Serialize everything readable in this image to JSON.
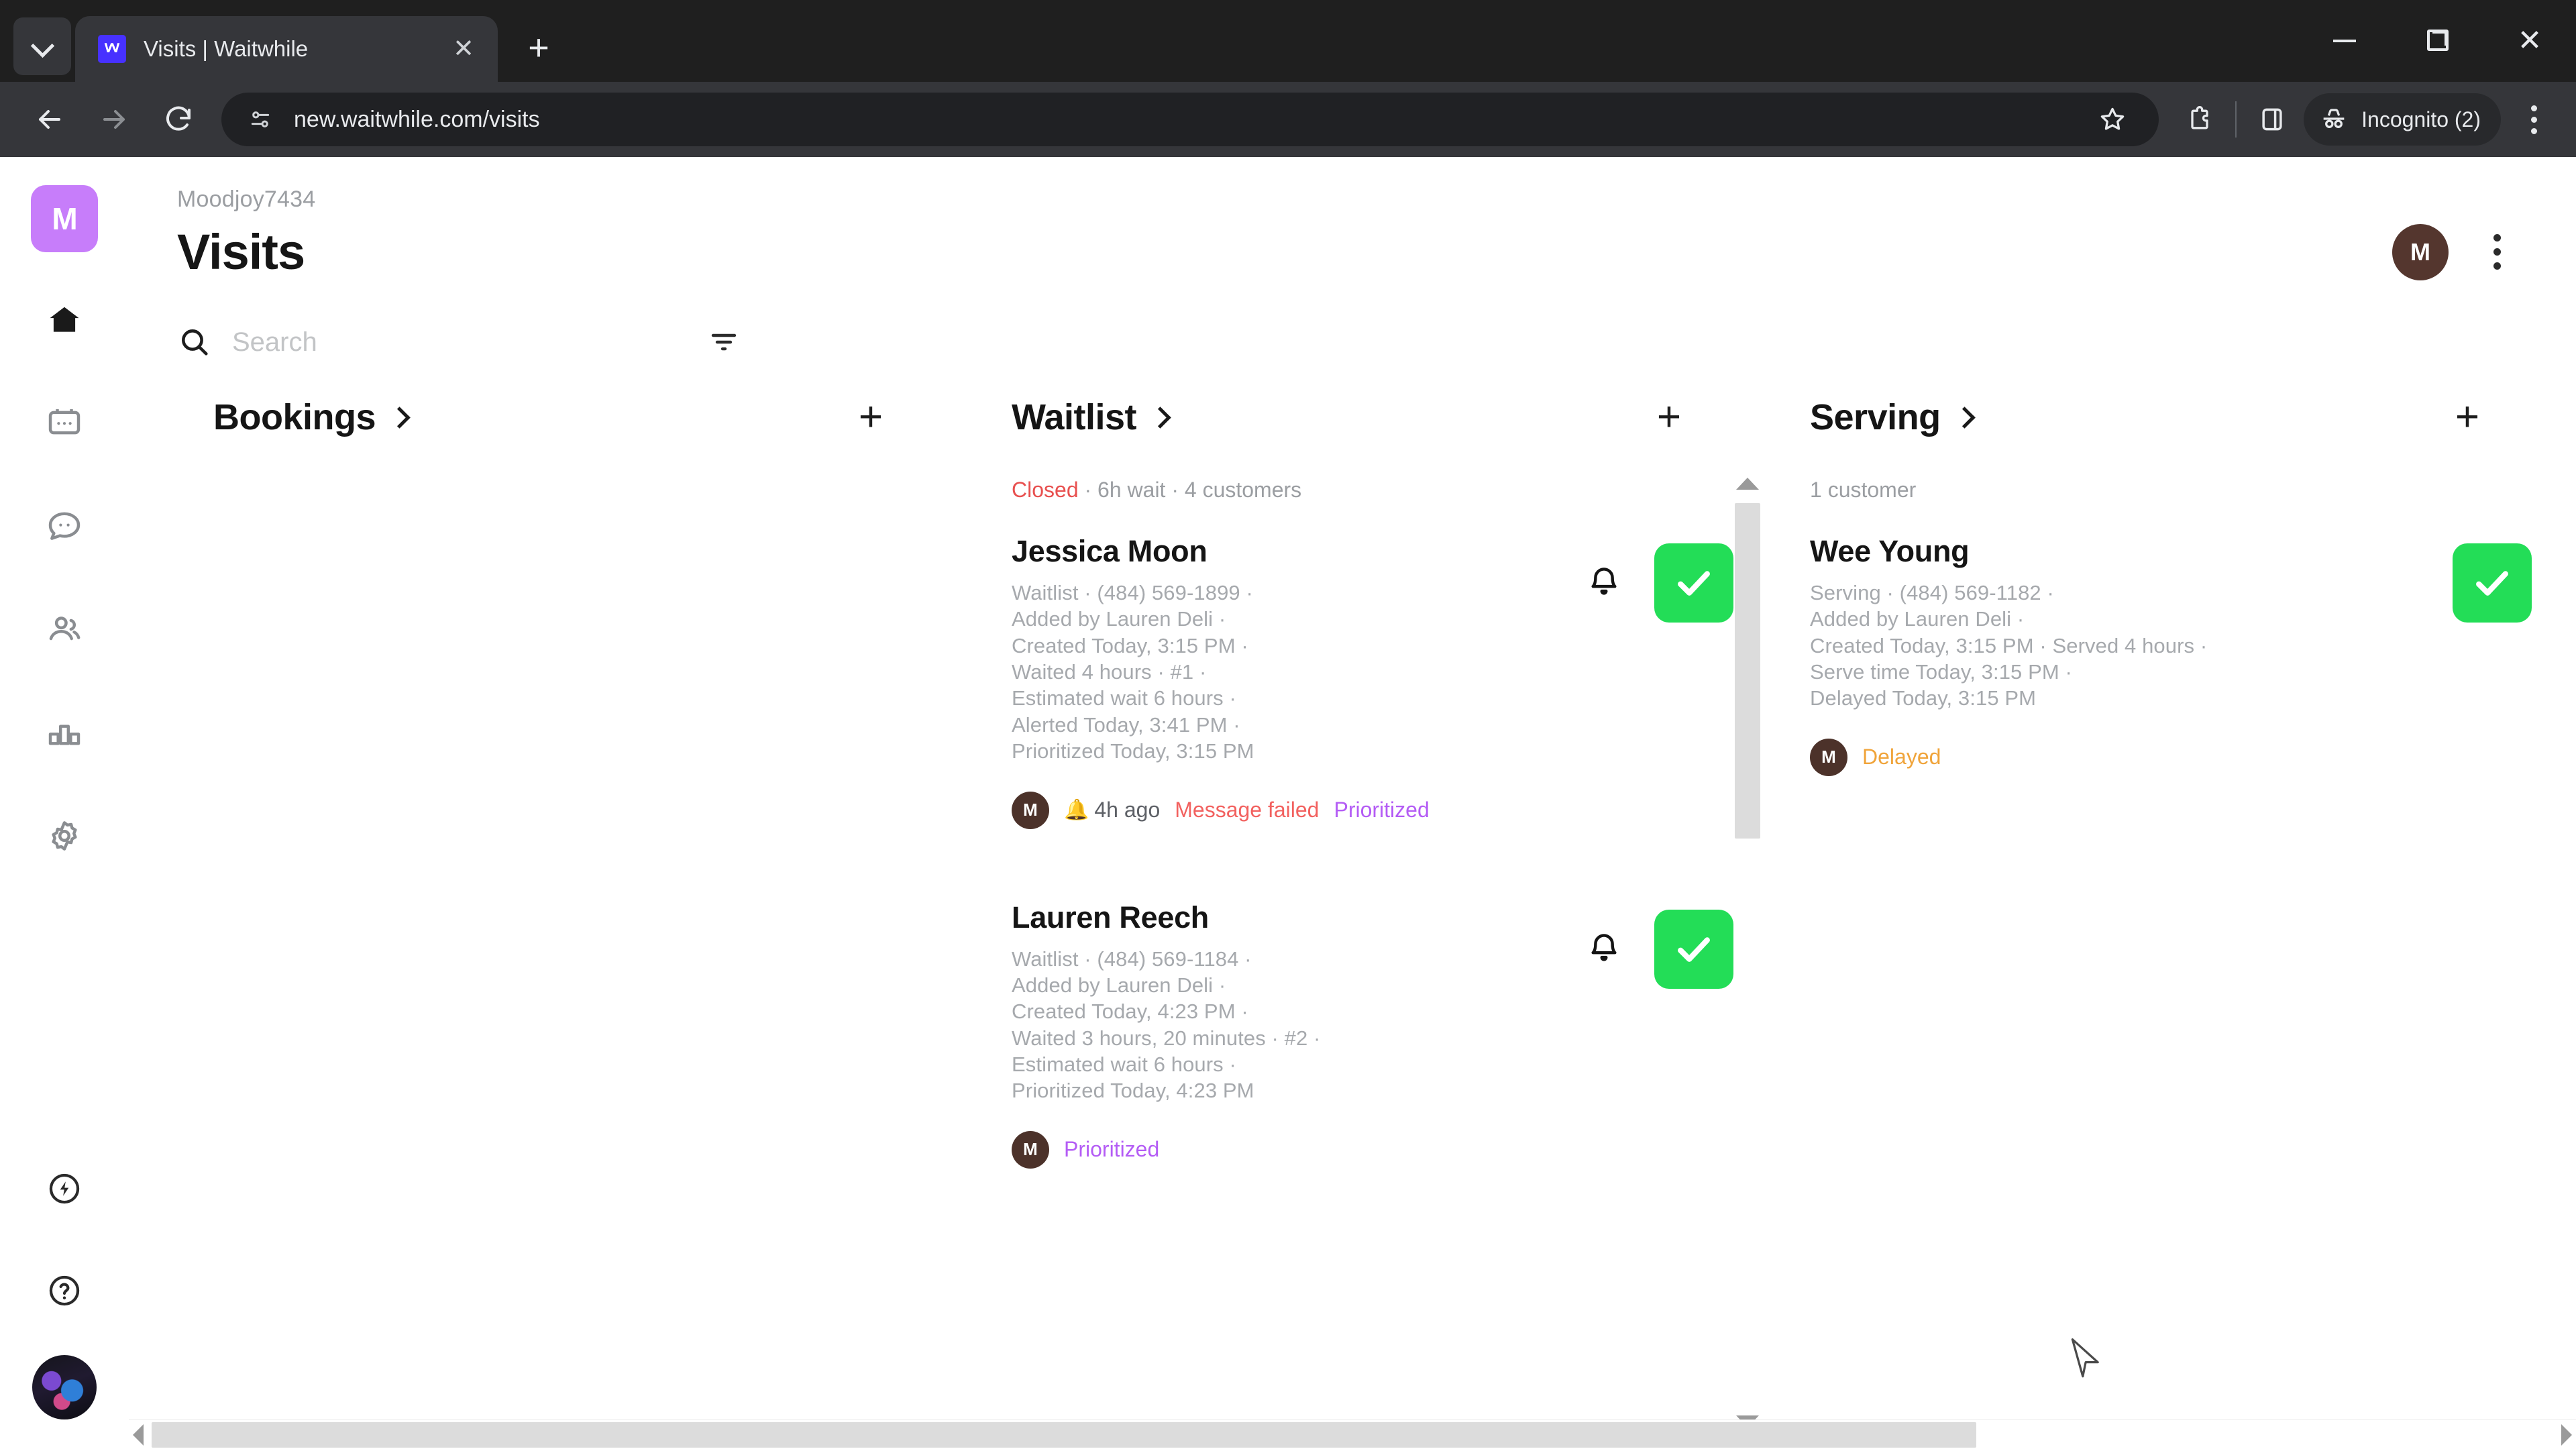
{
  "browser": {
    "tab": {
      "title": "Visits | Waitwhile",
      "favicon_icon": "waitwhile-logo-icon",
      "close_icon": "close-icon"
    },
    "tab_search_icon": "chevron-down-icon",
    "new_tab_icon": "plus-icon",
    "window": {
      "minimize_icon": "minimize-icon",
      "maximize_icon": "restore-icon",
      "close_icon": "close-icon"
    },
    "nav": {
      "back_icon": "back-arrow-icon",
      "forward_icon": "forward-arrow-icon",
      "reload_icon": "reload-icon"
    },
    "omnibox": {
      "url": "new.waitwhile.com/visits",
      "site_info_icon": "page-settings-icon",
      "bookmark_icon": "star-icon"
    },
    "toolbar": {
      "extensions_icon": "extensions-puzzle-icon",
      "side_panel_icon": "side-panel-icon",
      "incognito_icon": "incognito-hat-icon",
      "incognito_label": "Incognito (2)",
      "menu_icon": "kebab-menu-icon"
    }
  },
  "app": {
    "sidebar": {
      "brand_initial": "M",
      "brand_color": "#c77dfa",
      "items": [
        {
          "name": "home",
          "icon": "home-icon",
          "active": true
        },
        {
          "name": "bookings",
          "icon": "calendar-icon",
          "active": false
        },
        {
          "name": "messages",
          "icon": "chat-bubble-icon",
          "active": false
        },
        {
          "name": "customers",
          "icon": "people-icon",
          "active": false
        },
        {
          "name": "analytics",
          "icon": "bar-chart-icon",
          "active": false
        },
        {
          "name": "settings",
          "icon": "gear-icon",
          "active": false
        }
      ],
      "bottom_items": [
        {
          "name": "whats-new",
          "icon": "lightning-bolt-icon"
        },
        {
          "name": "help",
          "icon": "question-mark-icon"
        },
        {
          "name": "user-profile",
          "icon": "avatar-photo-icon"
        }
      ]
    },
    "header": {
      "org_name": "Moodjoy7434",
      "page_title": "Visits",
      "avatar_initial": "M",
      "avatar_color": "#54362e",
      "menu_icon": "kebab-menu-icon"
    },
    "search": {
      "placeholder": "Search",
      "value": "",
      "search_icon": "search-icon",
      "filter_icon": "filter-icon"
    },
    "columns": [
      {
        "id": "bookings",
        "title": "Bookings",
        "expand_icon": "chevron-right-icon",
        "add_label": "+",
        "subtitle": "",
        "cards": []
      },
      {
        "id": "waitlist",
        "title": "Waitlist",
        "expand_icon": "chevron-right-icon",
        "add_label": "+",
        "subtitle_status": "Closed",
        "subtitle_rest": " · 6h wait · 4 customers",
        "cards": [
          {
            "name": "Jessica Moon",
            "meta": [
              "Waitlist · (484) 569-1899 ·",
              "Added by Lauren Deli ·",
              "Created Today, 3:15 PM ·",
              "Waited 4 hours · #1 ·",
              "Estimated wait 6 hours ·",
              "Alerted Today, 3:41 PM ·",
              "Prioritized Today, 3:15 PM"
            ],
            "avatar_initial": "M",
            "badges": [
              {
                "type": "time",
                "icon": "bell-emoji-icon",
                "label": "4h ago"
              },
              {
                "type": "failed",
                "label": "Message failed"
              },
              {
                "type": "prioritized",
                "label": "Prioritized"
              }
            ],
            "bell_icon": "bell-icon",
            "check_icon": "check-icon"
          },
          {
            "name": "Lauren Reech",
            "meta": [
              "Waitlist · (484) 569-1184 ·",
              "Added by Lauren Deli ·",
              "Created Today, 4:23 PM ·",
              "Waited 3 hours, 20 minutes · #2 ·",
              "Estimated wait 6 hours ·",
              "Prioritized Today, 4:23 PM"
            ],
            "avatar_initial": "M",
            "badges": [
              {
                "type": "prioritized",
                "label": "Prioritized"
              }
            ],
            "bell_icon": "bell-icon",
            "check_icon": "check-icon"
          }
        ]
      },
      {
        "id": "serving",
        "title": "Serving",
        "expand_icon": "chevron-right-icon",
        "add_label": "+",
        "subtitle": "1 customer",
        "cards": [
          {
            "name": "Wee Young",
            "meta": [
              "Serving · (484) 569-1182 ·",
              "Added by Lauren Deli ·",
              "Created Today, 3:15 PM · Served 4 hours ·",
              "Serve time Today, 3:15 PM ·",
              "Delayed Today, 3:15 PM"
            ],
            "avatar_initial": "M",
            "badges": [
              {
                "type": "delayed",
                "label": "Delayed"
              }
            ],
            "check_icon": "check-icon"
          }
        ]
      }
    ],
    "colors": {
      "accent_green": "#23dd57",
      "closed_red": "#e8504f",
      "failed_red": "#f2615f",
      "prioritized_purple": "#b45cf5",
      "delayed_orange": "#f0a43a"
    },
    "scrollbars": {
      "vertical_icon": "vertical-scrollbar",
      "horizontal_icon": "horizontal-scrollbar"
    }
  }
}
